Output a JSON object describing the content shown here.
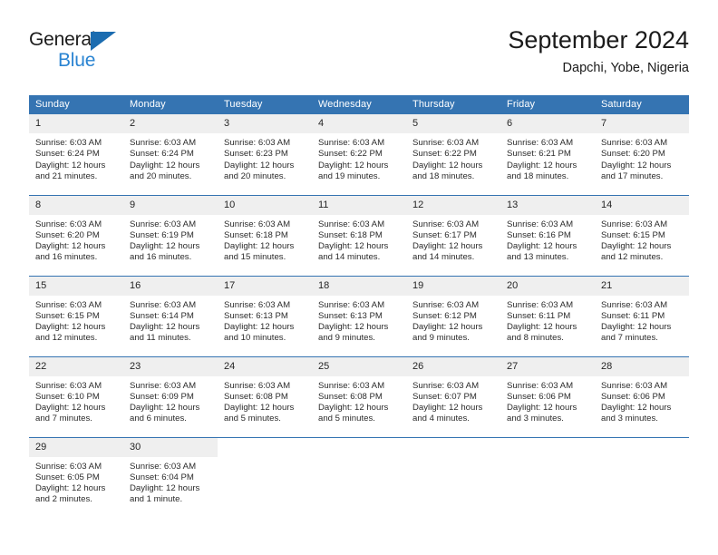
{
  "brand": {
    "name_primary": "General",
    "name_secondary": "Blue",
    "triangle_icon": "triangle-icon",
    "accent_color": "#2a84d2",
    "logo_triangle_color": "#1b6cb0"
  },
  "header": {
    "title": "September 2024",
    "subtitle": "Dapchi, Yobe, Nigeria"
  },
  "calendar": {
    "header_bg_color": "#3574b2",
    "daynum_bg_color": "#efefef",
    "weekday_headers": [
      "Sunday",
      "Monday",
      "Tuesday",
      "Wednesday",
      "Thursday",
      "Friday",
      "Saturday"
    ],
    "weeks": [
      [
        {
          "day": "1",
          "sunrise": "Sunrise: 6:03 AM",
          "sunset": "Sunset: 6:24 PM",
          "daylight_line1": "Daylight: 12 hours",
          "daylight_line2": "and 21 minutes."
        },
        {
          "day": "2",
          "sunrise": "Sunrise: 6:03 AM",
          "sunset": "Sunset: 6:24 PM",
          "daylight_line1": "Daylight: 12 hours",
          "daylight_line2": "and 20 minutes."
        },
        {
          "day": "3",
          "sunrise": "Sunrise: 6:03 AM",
          "sunset": "Sunset: 6:23 PM",
          "daylight_line1": "Daylight: 12 hours",
          "daylight_line2": "and 20 minutes."
        },
        {
          "day": "4",
          "sunrise": "Sunrise: 6:03 AM",
          "sunset": "Sunset: 6:22 PM",
          "daylight_line1": "Daylight: 12 hours",
          "daylight_line2": "and 19 minutes."
        },
        {
          "day": "5",
          "sunrise": "Sunrise: 6:03 AM",
          "sunset": "Sunset: 6:22 PM",
          "daylight_line1": "Daylight: 12 hours",
          "daylight_line2": "and 18 minutes."
        },
        {
          "day": "6",
          "sunrise": "Sunrise: 6:03 AM",
          "sunset": "Sunset: 6:21 PM",
          "daylight_line1": "Daylight: 12 hours",
          "daylight_line2": "and 18 minutes."
        },
        {
          "day": "7",
          "sunrise": "Sunrise: 6:03 AM",
          "sunset": "Sunset: 6:20 PM",
          "daylight_line1": "Daylight: 12 hours",
          "daylight_line2": "and 17 minutes."
        }
      ],
      [
        {
          "day": "8",
          "sunrise": "Sunrise: 6:03 AM",
          "sunset": "Sunset: 6:20 PM",
          "daylight_line1": "Daylight: 12 hours",
          "daylight_line2": "and 16 minutes."
        },
        {
          "day": "9",
          "sunrise": "Sunrise: 6:03 AM",
          "sunset": "Sunset: 6:19 PM",
          "daylight_line1": "Daylight: 12 hours",
          "daylight_line2": "and 16 minutes."
        },
        {
          "day": "10",
          "sunrise": "Sunrise: 6:03 AM",
          "sunset": "Sunset: 6:18 PM",
          "daylight_line1": "Daylight: 12 hours",
          "daylight_line2": "and 15 minutes."
        },
        {
          "day": "11",
          "sunrise": "Sunrise: 6:03 AM",
          "sunset": "Sunset: 6:18 PM",
          "daylight_line1": "Daylight: 12 hours",
          "daylight_line2": "and 14 minutes."
        },
        {
          "day": "12",
          "sunrise": "Sunrise: 6:03 AM",
          "sunset": "Sunset: 6:17 PM",
          "daylight_line1": "Daylight: 12 hours",
          "daylight_line2": "and 14 minutes."
        },
        {
          "day": "13",
          "sunrise": "Sunrise: 6:03 AM",
          "sunset": "Sunset: 6:16 PM",
          "daylight_line1": "Daylight: 12 hours",
          "daylight_line2": "and 13 minutes."
        },
        {
          "day": "14",
          "sunrise": "Sunrise: 6:03 AM",
          "sunset": "Sunset: 6:15 PM",
          "daylight_line1": "Daylight: 12 hours",
          "daylight_line2": "and 12 minutes."
        }
      ],
      [
        {
          "day": "15",
          "sunrise": "Sunrise: 6:03 AM",
          "sunset": "Sunset: 6:15 PM",
          "daylight_line1": "Daylight: 12 hours",
          "daylight_line2": "and 12 minutes."
        },
        {
          "day": "16",
          "sunrise": "Sunrise: 6:03 AM",
          "sunset": "Sunset: 6:14 PM",
          "daylight_line1": "Daylight: 12 hours",
          "daylight_line2": "and 11 minutes."
        },
        {
          "day": "17",
          "sunrise": "Sunrise: 6:03 AM",
          "sunset": "Sunset: 6:13 PM",
          "daylight_line1": "Daylight: 12 hours",
          "daylight_line2": "and 10 minutes."
        },
        {
          "day": "18",
          "sunrise": "Sunrise: 6:03 AM",
          "sunset": "Sunset: 6:13 PM",
          "daylight_line1": "Daylight: 12 hours",
          "daylight_line2": "and 9 minutes."
        },
        {
          "day": "19",
          "sunrise": "Sunrise: 6:03 AM",
          "sunset": "Sunset: 6:12 PM",
          "daylight_line1": "Daylight: 12 hours",
          "daylight_line2": "and 9 minutes."
        },
        {
          "day": "20",
          "sunrise": "Sunrise: 6:03 AM",
          "sunset": "Sunset: 6:11 PM",
          "daylight_line1": "Daylight: 12 hours",
          "daylight_line2": "and 8 minutes."
        },
        {
          "day": "21",
          "sunrise": "Sunrise: 6:03 AM",
          "sunset": "Sunset: 6:11 PM",
          "daylight_line1": "Daylight: 12 hours",
          "daylight_line2": "and 7 minutes."
        }
      ],
      [
        {
          "day": "22",
          "sunrise": "Sunrise: 6:03 AM",
          "sunset": "Sunset: 6:10 PM",
          "daylight_line1": "Daylight: 12 hours",
          "daylight_line2": "and 7 minutes."
        },
        {
          "day": "23",
          "sunrise": "Sunrise: 6:03 AM",
          "sunset": "Sunset: 6:09 PM",
          "daylight_line1": "Daylight: 12 hours",
          "daylight_line2": "and 6 minutes."
        },
        {
          "day": "24",
          "sunrise": "Sunrise: 6:03 AM",
          "sunset": "Sunset: 6:08 PM",
          "daylight_line1": "Daylight: 12 hours",
          "daylight_line2": "and 5 minutes."
        },
        {
          "day": "25",
          "sunrise": "Sunrise: 6:03 AM",
          "sunset": "Sunset: 6:08 PM",
          "daylight_line1": "Daylight: 12 hours",
          "daylight_line2": "and 5 minutes."
        },
        {
          "day": "26",
          "sunrise": "Sunrise: 6:03 AM",
          "sunset": "Sunset: 6:07 PM",
          "daylight_line1": "Daylight: 12 hours",
          "daylight_line2": "and 4 minutes."
        },
        {
          "day": "27",
          "sunrise": "Sunrise: 6:03 AM",
          "sunset": "Sunset: 6:06 PM",
          "daylight_line1": "Daylight: 12 hours",
          "daylight_line2": "and 3 minutes."
        },
        {
          "day": "28",
          "sunrise": "Sunrise: 6:03 AM",
          "sunset": "Sunset: 6:06 PM",
          "daylight_line1": "Daylight: 12 hours",
          "daylight_line2": "and 3 minutes."
        }
      ],
      [
        {
          "day": "29",
          "sunrise": "Sunrise: 6:03 AM",
          "sunset": "Sunset: 6:05 PM",
          "daylight_line1": "Daylight: 12 hours",
          "daylight_line2": "and 2 minutes."
        },
        {
          "day": "30",
          "sunrise": "Sunrise: 6:03 AM",
          "sunset": "Sunset: 6:04 PM",
          "daylight_line1": "Daylight: 12 hours",
          "daylight_line2": "and 1 minute."
        },
        {
          "day": "",
          "sunrise": "",
          "sunset": "",
          "daylight_line1": "",
          "daylight_line2": ""
        },
        {
          "day": "",
          "sunrise": "",
          "sunset": "",
          "daylight_line1": "",
          "daylight_line2": ""
        },
        {
          "day": "",
          "sunrise": "",
          "sunset": "",
          "daylight_line1": "",
          "daylight_line2": ""
        },
        {
          "day": "",
          "sunrise": "",
          "sunset": "",
          "daylight_line1": "",
          "daylight_line2": ""
        },
        {
          "day": "",
          "sunrise": "",
          "sunset": "",
          "daylight_line1": "",
          "daylight_line2": ""
        }
      ]
    ]
  }
}
